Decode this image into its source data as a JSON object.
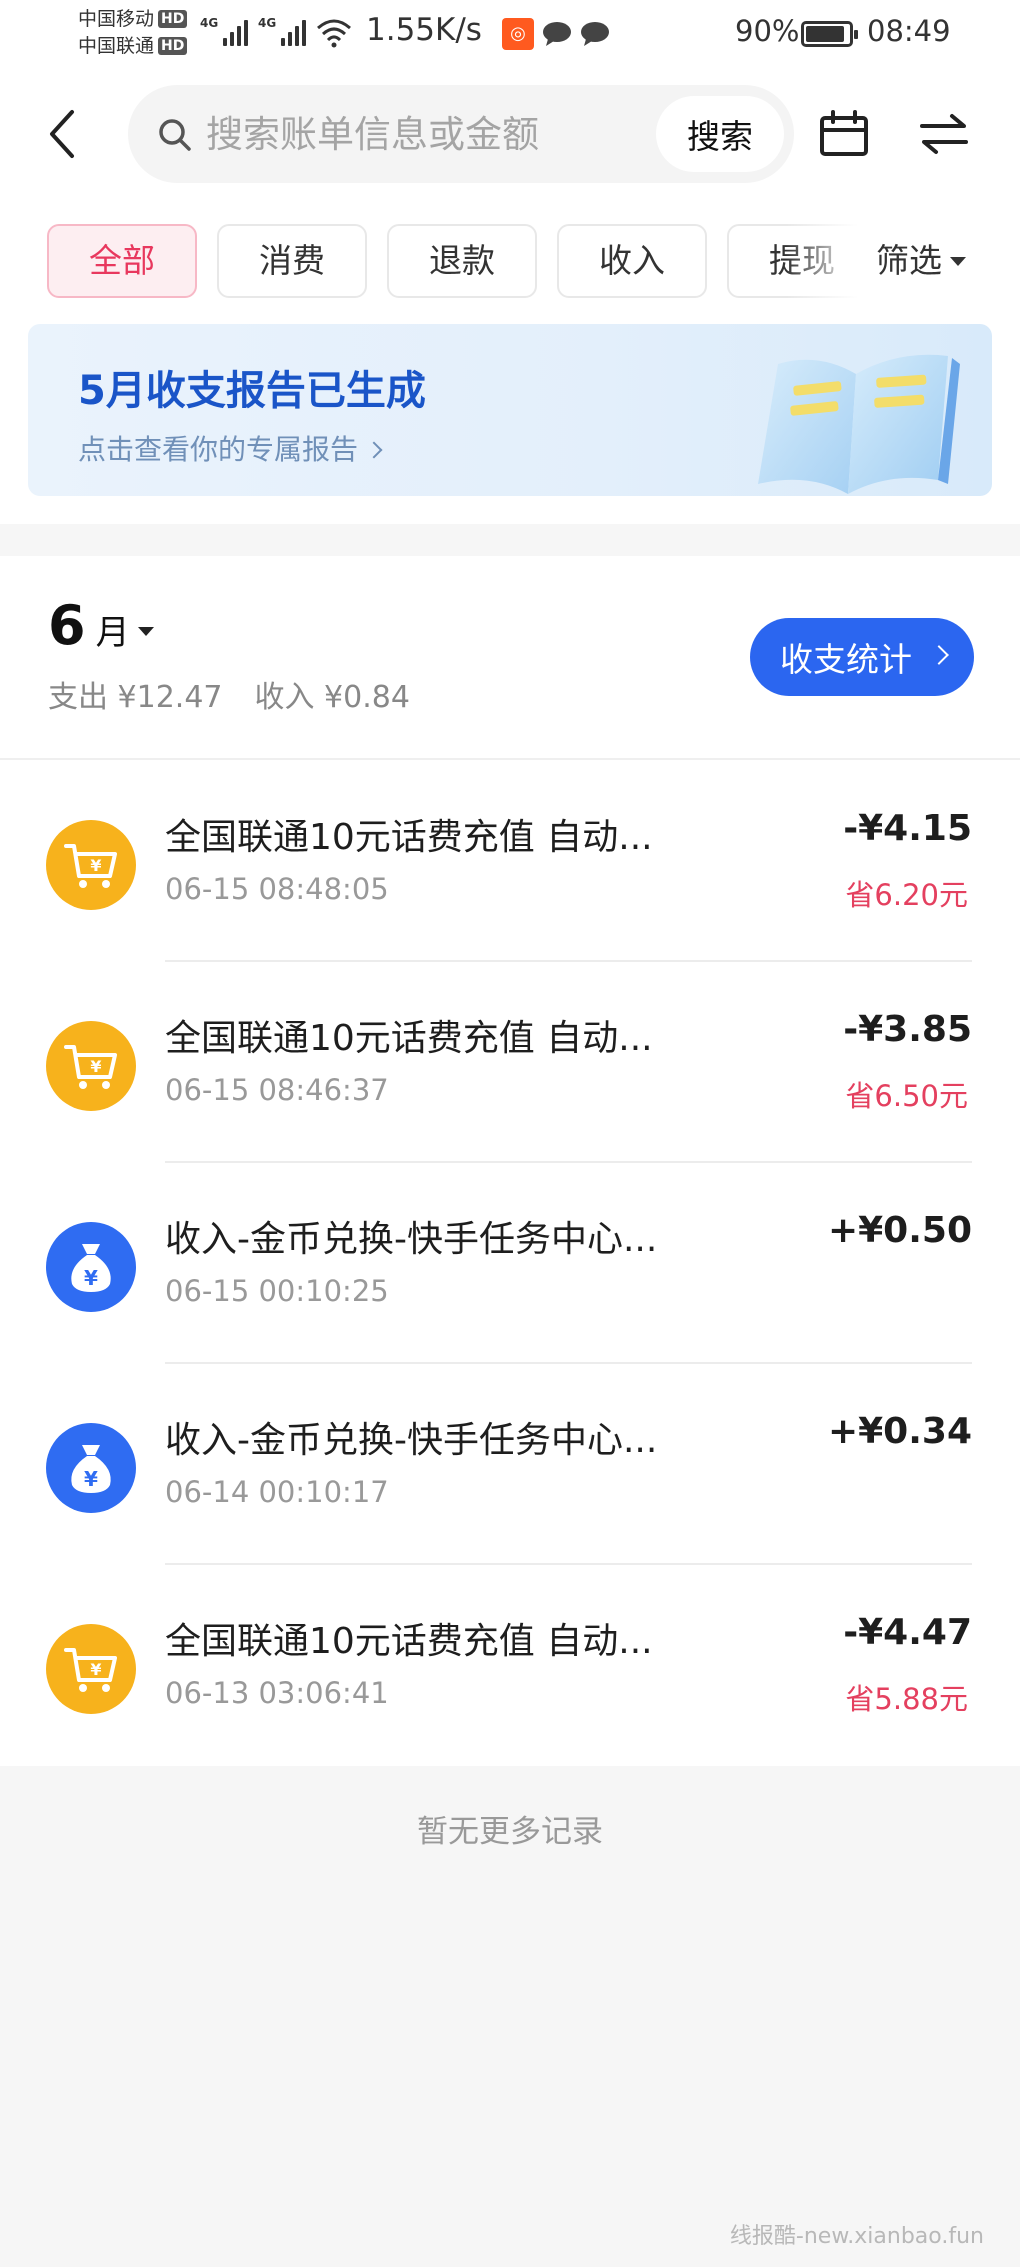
{
  "status_bar": {
    "carrier1": "中国移动",
    "carrier2": "中国联通",
    "hd_label": "HD",
    "network_label": "4G",
    "net_speed": "1.55K/s",
    "battery_text": "90%",
    "battery_level": 0.9,
    "time": "08:49"
  },
  "header": {
    "search_placeholder": "搜索账单信息或金额",
    "search_button": "搜索"
  },
  "filters": {
    "tabs": [
      {
        "label": "全部",
        "active": true
      },
      {
        "label": "消费",
        "active": false
      },
      {
        "label": "退款",
        "active": false
      },
      {
        "label": "收入",
        "active": false
      },
      {
        "label": "提现",
        "active": false
      }
    ],
    "filter_label": "筛选"
  },
  "banner": {
    "title": "5月收支报告已生成",
    "subtitle": "点击查看你的专属报告"
  },
  "month_section": {
    "month_number": "6",
    "month_unit": "月",
    "expense": "支出 ¥12.47",
    "income": "收入 ¥0.84",
    "stats_button": "收支统计"
  },
  "records": [
    {
      "type": "shopping",
      "title": "全国联通10元话费充值 自动...",
      "time": "06-15 08:48:05",
      "amount": "-¥4.15",
      "saving": "省6.20元"
    },
    {
      "type": "shopping",
      "title": "全国联通10元话费充值 自动...",
      "time": "06-15 08:46:37",
      "amount": "-¥3.85",
      "saving": "省6.50元"
    },
    {
      "type": "income",
      "title": "收入-金币兑换-快手任务中心...",
      "time": "06-15 00:10:25",
      "amount": "+¥0.50",
      "saving": ""
    },
    {
      "type": "income",
      "title": "收入-金币兑换-快手任务中心...",
      "time": "06-14 00:10:17",
      "amount": "+¥0.34",
      "saving": ""
    },
    {
      "type": "shopping",
      "title": "全国联通10元话费充值 自动...",
      "time": "06-13 03:06:41",
      "amount": "-¥4.47",
      "saving": "省5.88元"
    }
  ],
  "footer": {
    "no_more": "暂无更多记录",
    "watermark": "线报酷-new.xianbao.fun"
  },
  "colors": {
    "accent_blue": "#2b66f0",
    "active_tab_text": "#e8385e",
    "saving_red": "#e4405f",
    "shopping_icon": "#f7b21c",
    "income_icon": "#2f6cf2"
  },
  "icons": {
    "back": "chevron-left-icon",
    "search": "search-icon",
    "calendar": "calendar-icon",
    "swap": "swap-arrows-icon",
    "shopping": "shopping-cart-yuan-icon",
    "income": "money-bag-yuan-icon"
  }
}
